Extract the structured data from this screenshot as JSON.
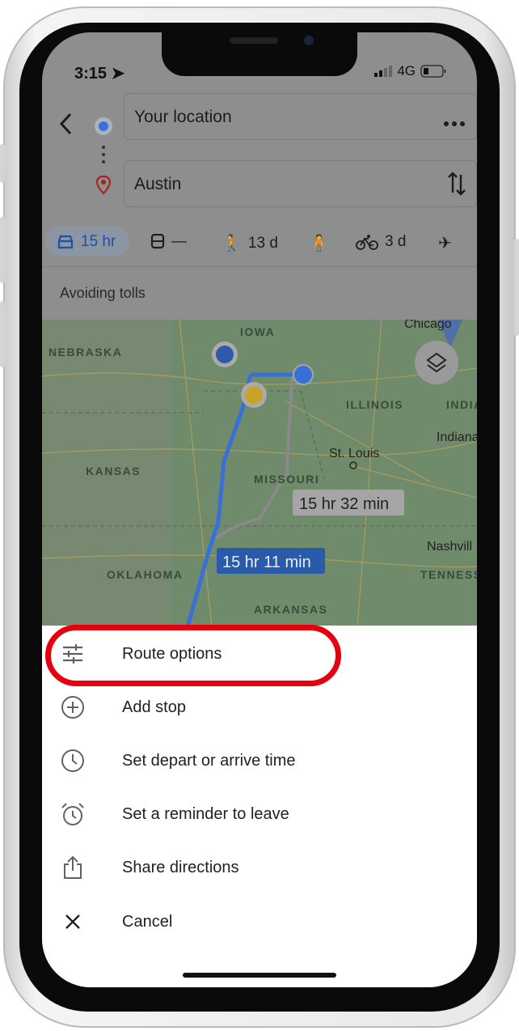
{
  "status_bar": {
    "time": "3:15",
    "network": "4G"
  },
  "directions": {
    "origin": "Your location",
    "destination": "Austin"
  },
  "modes": [
    {
      "icon": "car-icon",
      "label": "15 hr",
      "selected": true
    },
    {
      "icon": "transit-icon",
      "label": "—"
    },
    {
      "icon": "walk-icon",
      "label": "13 d"
    },
    {
      "icon": "ride-icon",
      "label": ""
    },
    {
      "icon": "bike-icon",
      "label": "3 d"
    },
    {
      "icon": "flight-icon",
      "label": ""
    }
  ],
  "route_note": "Avoiding tolls",
  "map": {
    "labels": [
      "IOWA",
      "NEBRASKA",
      "ILLINOIS",
      "INDIA",
      "Chicago",
      "Indiana",
      "St. Louis",
      "KANSAS",
      "MISSOURI",
      "OKLAHOMA",
      "Nashvill",
      "TENNESS",
      "ARKANSAS"
    ],
    "route_primary": "15 hr 11 min",
    "route_alt": "15 hr 32 min",
    "route_color": "#3b6fd8"
  },
  "menu": [
    {
      "icon": "sliders-icon",
      "label": "Route options"
    },
    {
      "icon": "add-circle-icon",
      "label": "Add stop"
    },
    {
      "icon": "clock-icon",
      "label": "Set depart or arrive time"
    },
    {
      "icon": "alarm-icon",
      "label": "Set a reminder to leave"
    },
    {
      "icon": "share-icon",
      "label": "Share directions"
    },
    {
      "icon": "close-icon",
      "label": "Cancel"
    }
  ],
  "highlight_color": "#e5000e"
}
